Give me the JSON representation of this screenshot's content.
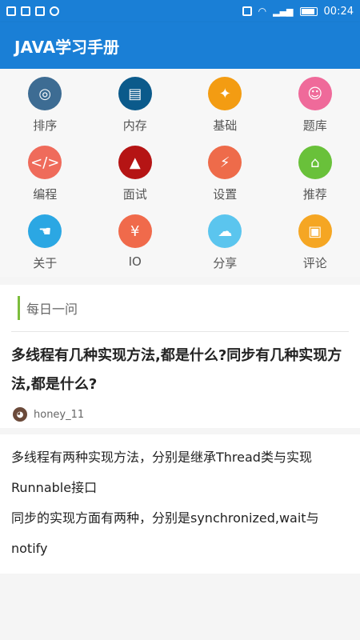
{
  "status_bar": {
    "time": "00:24",
    "left_icons": [
      "grid-icon",
      "usb-icon",
      "s-app-icon",
      "chat-icon"
    ],
    "right_icons": [
      "vibrate-icon",
      "wifi-icon",
      "signal-icon",
      "battery-icon"
    ]
  },
  "app": {
    "title": "JAVA学习手册"
  },
  "grid": {
    "items": [
      {
        "label": "排序",
        "icon": "globe-icon",
        "color": "#3d6c93",
        "glyph": "◎"
      },
      {
        "label": "内存",
        "icon": "document-icon",
        "color": "#0b5a8b",
        "glyph": "▤"
      },
      {
        "label": "基础",
        "icon": "bottle-icon",
        "color": "#f39c12",
        "glyph": "✦"
      },
      {
        "label": "题库",
        "icon": "head-icon",
        "color": "#ef6a9a",
        "glyph": "☺"
      },
      {
        "label": "编程",
        "icon": "code-icon",
        "color": "#ef6b5b",
        "glyph": "</>"
      },
      {
        "label": "面试",
        "icon": "graduation-cap-icon",
        "color": "#b51414",
        "glyph": "▲"
      },
      {
        "label": "设置",
        "icon": "flash-tag-icon",
        "color": "#ee6b4a",
        "glyph": "⚡"
      },
      {
        "label": "推荐",
        "icon": "home-icon",
        "color": "#69c13a",
        "glyph": "⌂"
      },
      {
        "label": "关于",
        "icon": "footprint-icon",
        "color": "#2ba7e3",
        "glyph": "☚"
      },
      {
        "label": "IO",
        "icon": "download-icon",
        "color": "#f06a4b",
        "glyph": "¥"
      },
      {
        "label": "分享",
        "icon": "cloud-icon",
        "color": "#5bc5ee",
        "glyph": "☁"
      },
      {
        "label": "评论",
        "icon": "tablet-icon",
        "color": "#f5a623",
        "glyph": "▣"
      }
    ]
  },
  "daily": {
    "title": "每日一问",
    "accent_color": "#7cbd3c",
    "question": "多线程有几种实现方法,都是什么?同步有几种实现方法,都是什么?",
    "author": "honey_11",
    "answer_line1": "多线程有两种实现方法，分别是继承Thread类与实现Runnable接口",
    "answer_line2": "同步的实现方面有两种，分别是synchronized,wait与notify"
  }
}
